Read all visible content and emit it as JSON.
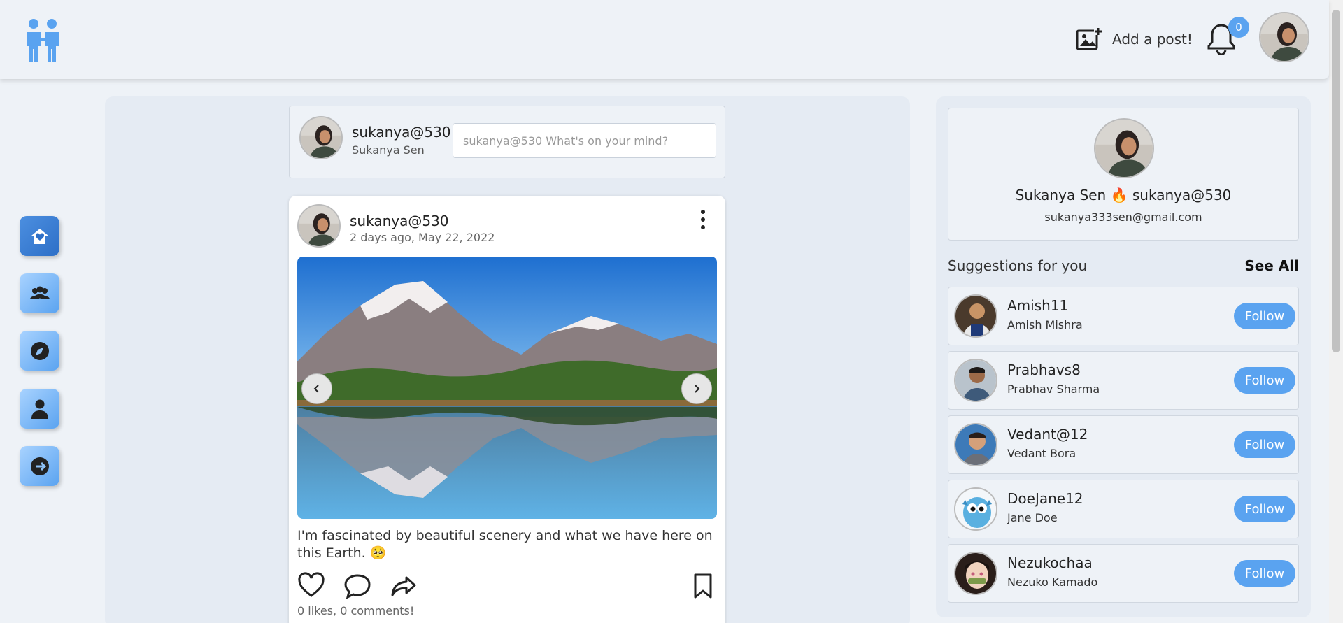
{
  "header": {
    "logo_icon": "people-logo-icon",
    "add_post_label": "Add a post!",
    "add_post_icon": "add-image-icon",
    "notification_count": "0",
    "bell_icon": "bell-icon",
    "accent_color": "#5aa3f0"
  },
  "nav": {
    "items": [
      {
        "icon": "home-icon",
        "active": true
      },
      {
        "icon": "people-icon",
        "active": false
      },
      {
        "icon": "compass-icon",
        "active": false
      },
      {
        "icon": "user-icon",
        "active": false
      },
      {
        "icon": "logout-icon",
        "active": false
      }
    ]
  },
  "composer": {
    "username": "sukanya@530",
    "full_name": "Sukanya Sen",
    "placeholder": "sukanya@530 What's on your mind?"
  },
  "post": {
    "username": "sukanya@530",
    "date": "2 days ago, May 22, 2022",
    "caption": "I'm fascinated by beautiful scenery and what we have here on this Earth. 🥺",
    "stats": "0 likes, 0 comments!",
    "image_alt": "mountain lake reflection"
  },
  "profile": {
    "full_name": "Sukanya Sen",
    "emoji": "🔥",
    "username": "sukanya@530",
    "email": "sukanya333sen@gmail.com"
  },
  "suggestions": {
    "title": "Suggestions for you",
    "see_all_label": "See All",
    "follow_label": "Follow",
    "items": [
      {
        "username": "Amish11",
        "name": "Amish Mishra",
        "avatar_color": "#4a3a2c"
      },
      {
        "username": "Prabhavs8",
        "name": "Prabhav Sharma",
        "avatar_color": "#3e5a7a"
      },
      {
        "username": "Vedant@12",
        "name": "Vedant Bora",
        "avatar_color": "#3d7ab8"
      },
      {
        "username": "DoeJane12",
        "name": "Jane Doe",
        "avatar_color": "#5ab0e0"
      },
      {
        "username": "Nezukochaa",
        "name": "Nezuko Kamado",
        "avatar_color": "#2a1e1a"
      }
    ]
  }
}
